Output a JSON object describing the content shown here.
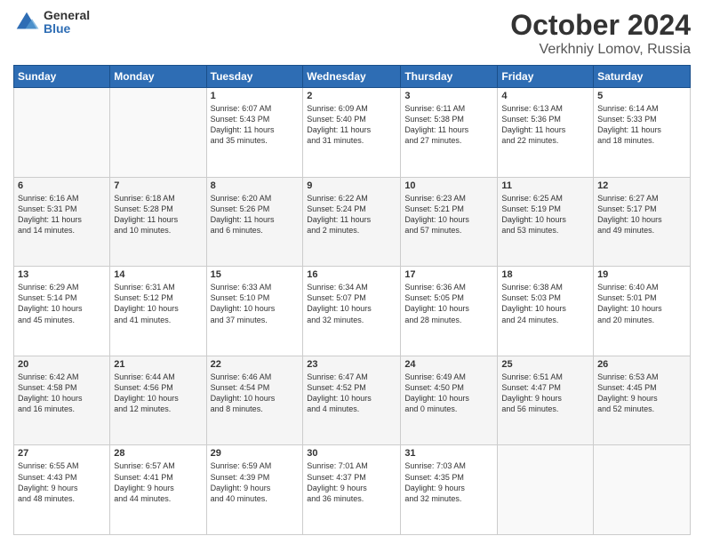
{
  "logo": {
    "general": "General",
    "blue": "Blue"
  },
  "header": {
    "title": "October 2024",
    "location": "Verkhniy Lomov, Russia"
  },
  "days": [
    "Sunday",
    "Monday",
    "Tuesday",
    "Wednesday",
    "Thursday",
    "Friday",
    "Saturday"
  ],
  "weeks": [
    [
      {
        "day": "",
        "lines": []
      },
      {
        "day": "",
        "lines": []
      },
      {
        "day": "1",
        "lines": [
          "Sunrise: 6:07 AM",
          "Sunset: 5:43 PM",
          "Daylight: 11 hours",
          "and 35 minutes."
        ]
      },
      {
        "day": "2",
        "lines": [
          "Sunrise: 6:09 AM",
          "Sunset: 5:40 PM",
          "Daylight: 11 hours",
          "and 31 minutes."
        ]
      },
      {
        "day": "3",
        "lines": [
          "Sunrise: 6:11 AM",
          "Sunset: 5:38 PM",
          "Daylight: 11 hours",
          "and 27 minutes."
        ]
      },
      {
        "day": "4",
        "lines": [
          "Sunrise: 6:13 AM",
          "Sunset: 5:36 PM",
          "Daylight: 11 hours",
          "and 22 minutes."
        ]
      },
      {
        "day": "5",
        "lines": [
          "Sunrise: 6:14 AM",
          "Sunset: 5:33 PM",
          "Daylight: 11 hours",
          "and 18 minutes."
        ]
      }
    ],
    [
      {
        "day": "6",
        "lines": [
          "Sunrise: 6:16 AM",
          "Sunset: 5:31 PM",
          "Daylight: 11 hours",
          "and 14 minutes."
        ]
      },
      {
        "day": "7",
        "lines": [
          "Sunrise: 6:18 AM",
          "Sunset: 5:28 PM",
          "Daylight: 11 hours",
          "and 10 minutes."
        ]
      },
      {
        "day": "8",
        "lines": [
          "Sunrise: 6:20 AM",
          "Sunset: 5:26 PM",
          "Daylight: 11 hours",
          "and 6 minutes."
        ]
      },
      {
        "day": "9",
        "lines": [
          "Sunrise: 6:22 AM",
          "Sunset: 5:24 PM",
          "Daylight: 11 hours",
          "and 2 minutes."
        ]
      },
      {
        "day": "10",
        "lines": [
          "Sunrise: 6:23 AM",
          "Sunset: 5:21 PM",
          "Daylight: 10 hours",
          "and 57 minutes."
        ]
      },
      {
        "day": "11",
        "lines": [
          "Sunrise: 6:25 AM",
          "Sunset: 5:19 PM",
          "Daylight: 10 hours",
          "and 53 minutes."
        ]
      },
      {
        "day": "12",
        "lines": [
          "Sunrise: 6:27 AM",
          "Sunset: 5:17 PM",
          "Daylight: 10 hours",
          "and 49 minutes."
        ]
      }
    ],
    [
      {
        "day": "13",
        "lines": [
          "Sunrise: 6:29 AM",
          "Sunset: 5:14 PM",
          "Daylight: 10 hours",
          "and 45 minutes."
        ]
      },
      {
        "day": "14",
        "lines": [
          "Sunrise: 6:31 AM",
          "Sunset: 5:12 PM",
          "Daylight: 10 hours",
          "and 41 minutes."
        ]
      },
      {
        "day": "15",
        "lines": [
          "Sunrise: 6:33 AM",
          "Sunset: 5:10 PM",
          "Daylight: 10 hours",
          "and 37 minutes."
        ]
      },
      {
        "day": "16",
        "lines": [
          "Sunrise: 6:34 AM",
          "Sunset: 5:07 PM",
          "Daylight: 10 hours",
          "and 32 minutes."
        ]
      },
      {
        "day": "17",
        "lines": [
          "Sunrise: 6:36 AM",
          "Sunset: 5:05 PM",
          "Daylight: 10 hours",
          "and 28 minutes."
        ]
      },
      {
        "day": "18",
        "lines": [
          "Sunrise: 6:38 AM",
          "Sunset: 5:03 PM",
          "Daylight: 10 hours",
          "and 24 minutes."
        ]
      },
      {
        "day": "19",
        "lines": [
          "Sunrise: 6:40 AM",
          "Sunset: 5:01 PM",
          "Daylight: 10 hours",
          "and 20 minutes."
        ]
      }
    ],
    [
      {
        "day": "20",
        "lines": [
          "Sunrise: 6:42 AM",
          "Sunset: 4:58 PM",
          "Daylight: 10 hours",
          "and 16 minutes."
        ]
      },
      {
        "day": "21",
        "lines": [
          "Sunrise: 6:44 AM",
          "Sunset: 4:56 PM",
          "Daylight: 10 hours",
          "and 12 minutes."
        ]
      },
      {
        "day": "22",
        "lines": [
          "Sunrise: 6:46 AM",
          "Sunset: 4:54 PM",
          "Daylight: 10 hours",
          "and 8 minutes."
        ]
      },
      {
        "day": "23",
        "lines": [
          "Sunrise: 6:47 AM",
          "Sunset: 4:52 PM",
          "Daylight: 10 hours",
          "and 4 minutes."
        ]
      },
      {
        "day": "24",
        "lines": [
          "Sunrise: 6:49 AM",
          "Sunset: 4:50 PM",
          "Daylight: 10 hours",
          "and 0 minutes."
        ]
      },
      {
        "day": "25",
        "lines": [
          "Sunrise: 6:51 AM",
          "Sunset: 4:47 PM",
          "Daylight: 9 hours",
          "and 56 minutes."
        ]
      },
      {
        "day": "26",
        "lines": [
          "Sunrise: 6:53 AM",
          "Sunset: 4:45 PM",
          "Daylight: 9 hours",
          "and 52 minutes."
        ]
      }
    ],
    [
      {
        "day": "27",
        "lines": [
          "Sunrise: 6:55 AM",
          "Sunset: 4:43 PM",
          "Daylight: 9 hours",
          "and 48 minutes."
        ]
      },
      {
        "day": "28",
        "lines": [
          "Sunrise: 6:57 AM",
          "Sunset: 4:41 PM",
          "Daylight: 9 hours",
          "and 44 minutes."
        ]
      },
      {
        "day": "29",
        "lines": [
          "Sunrise: 6:59 AM",
          "Sunset: 4:39 PM",
          "Daylight: 9 hours",
          "and 40 minutes."
        ]
      },
      {
        "day": "30",
        "lines": [
          "Sunrise: 7:01 AM",
          "Sunset: 4:37 PM",
          "Daylight: 9 hours",
          "and 36 minutes."
        ]
      },
      {
        "day": "31",
        "lines": [
          "Sunrise: 7:03 AM",
          "Sunset: 4:35 PM",
          "Daylight: 9 hours",
          "and 32 minutes."
        ]
      },
      {
        "day": "",
        "lines": []
      },
      {
        "day": "",
        "lines": []
      }
    ]
  ]
}
